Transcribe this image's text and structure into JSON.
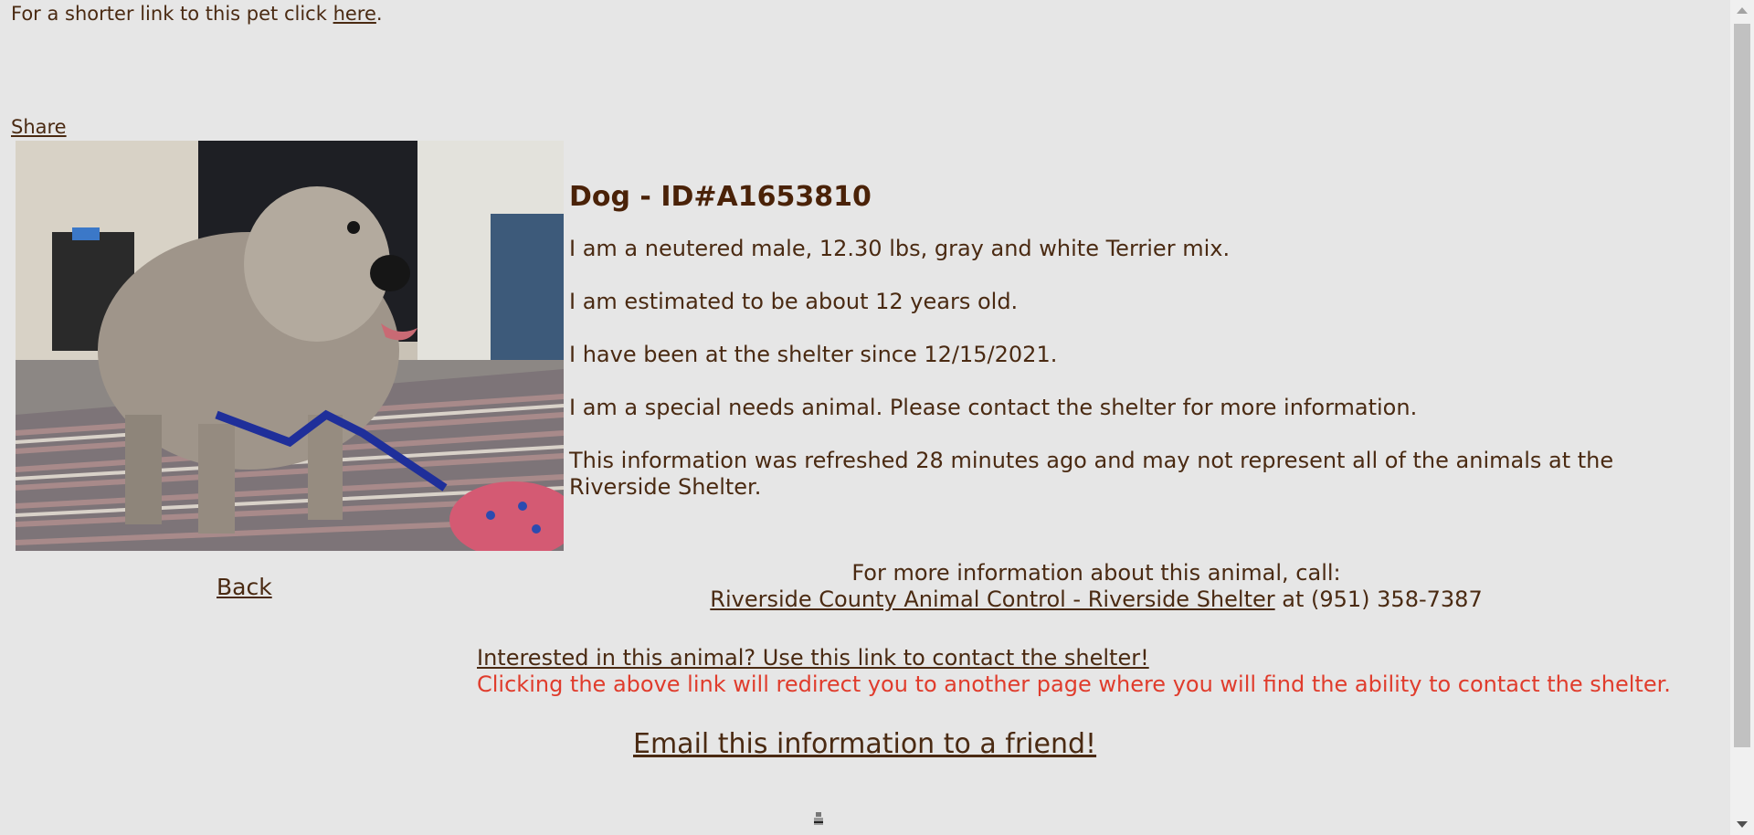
{
  "top": {
    "prefix": "For a shorter link to this pet click ",
    "link": "here",
    "suffix": "."
  },
  "share_label": "Share",
  "photo": {
    "icon": "dog-photo"
  },
  "back_label": "Back",
  "animal": {
    "title": "Dog - ID#A1653810",
    "description": "I am a neutered male, 12.30 lbs, gray and white Terrier mix.",
    "age": "I am estimated to be about 12 years old.",
    "since": "I have been at the shelter since 12/15/2021.",
    "special": "I am a special needs animal. Please contact the shelter for more information.",
    "refresh": "This information was refreshed 28 minutes ago and may not represent all of the animals at the Riverside Shelter."
  },
  "contact": {
    "intro": "For more information about this animal, call:",
    "shelter_link": "Riverside County Animal Control - Riverside Shelter",
    "phone_text": " at (951) 358-7387"
  },
  "interest": {
    "link": "Interested in this animal? Use this link to contact the shelter!",
    "note": "Clicking the above link will redirect you to another page where you will find the ability to contact the shelter.",
    "note_color": "#e03c2c"
  },
  "email_label": "Email this information to a friend!",
  "colors": {
    "background": "#e6e6e6",
    "text": "#4a2a12"
  }
}
